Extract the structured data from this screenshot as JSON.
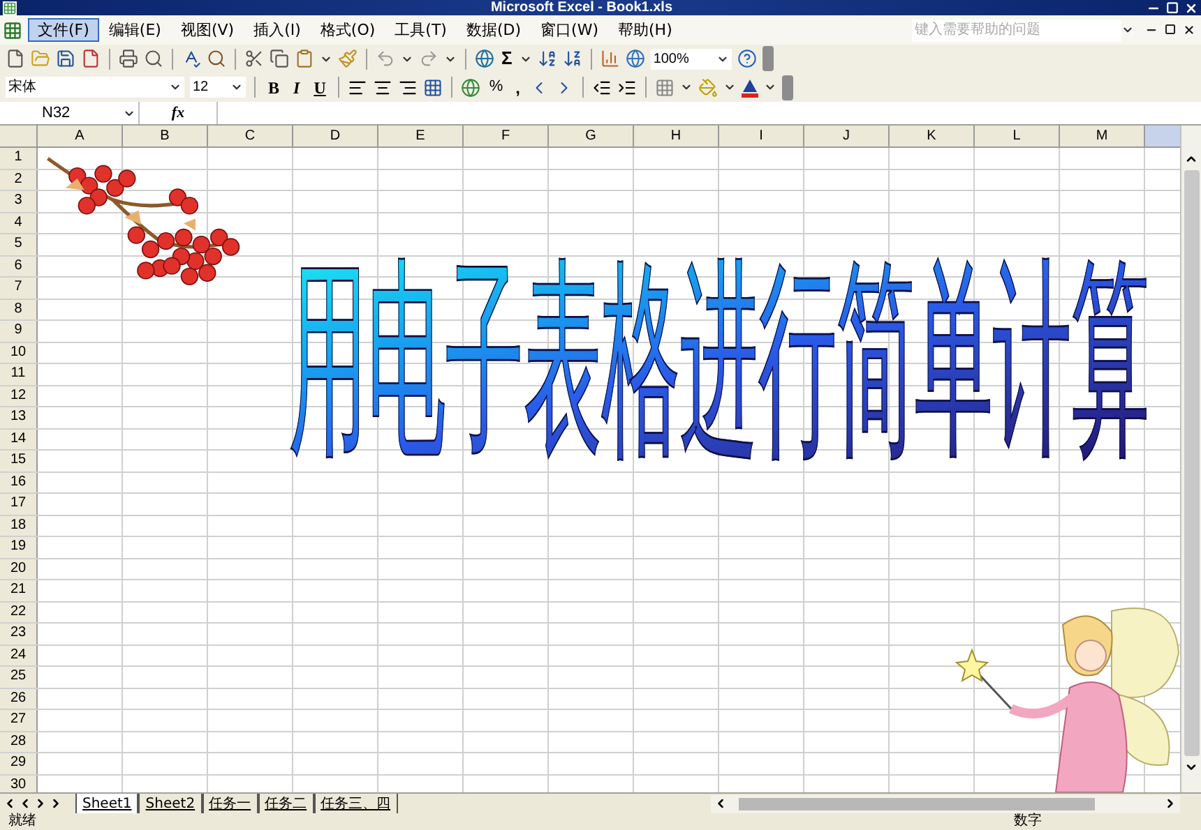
{
  "window": {
    "title": "Microsoft Excel - Book1.xls"
  },
  "menu": [
    {
      "label": "文件(F)",
      "selected": true
    },
    {
      "label": "编辑(E)",
      "selected": false
    },
    {
      "label": "视图(V)",
      "selected": false
    },
    {
      "label": "插入(I)",
      "selected": false
    },
    {
      "label": "格式(O)",
      "selected": false
    },
    {
      "label": "工具(T)",
      "selected": false
    },
    {
      "label": "数据(D)",
      "selected": false
    },
    {
      "label": "窗口(W)",
      "selected": false
    },
    {
      "label": "帮助(H)",
      "selected": false
    }
  ],
  "help_search": {
    "placeholder": "键入需要帮助的问题"
  },
  "standard_toolbar": {
    "autosum": "Σ",
    "zoom": "100%"
  },
  "formatting_toolbar": {
    "font": "宋体",
    "size": "12",
    "bold": "B",
    "italic": "I",
    "underline": "U",
    "percent": "%",
    "comma": ","
  },
  "formula_bar": {
    "name_box": "N32",
    "fx": "fx"
  },
  "columns": [
    "A",
    "B",
    "C",
    "D",
    "E",
    "F",
    "G",
    "H",
    "I",
    "J",
    "K",
    "L",
    "M"
  ],
  "rows": [
    "1",
    "2",
    "3",
    "4",
    "5",
    "6",
    "7",
    "8",
    "9",
    "10",
    "11",
    "12",
    "13",
    "14",
    "15",
    "16",
    "17",
    "18",
    "19",
    "20",
    "21",
    "22",
    "23",
    "24",
    "25",
    "26",
    "27",
    "28",
    "29",
    "30"
  ],
  "wordart": "用电子表格进行简单计算",
  "sheet_tabs": [
    {
      "label": "Sheet1",
      "selected": true
    },
    {
      "label": "Sheet2",
      "selected": false
    },
    {
      "label": "任务一",
      "selected": false
    },
    {
      "label": "任务二",
      "selected": false
    },
    {
      "label": "任务三、四",
      "selected": false
    }
  ],
  "status_bar": {
    "state": "就绪",
    "mode": "数字"
  }
}
